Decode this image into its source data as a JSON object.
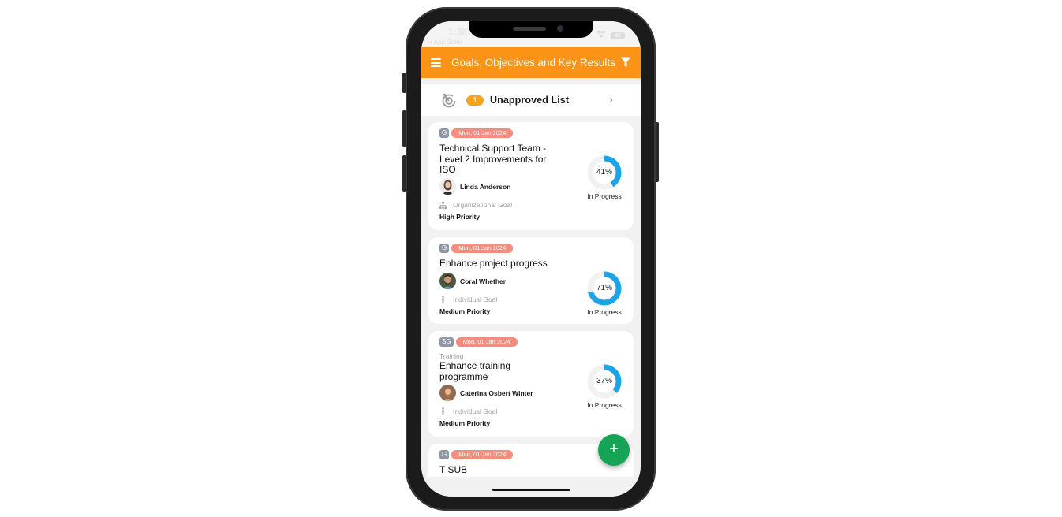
{
  "status_bar": {
    "time": "1:38",
    "back_label": "◂ App Store",
    "battery": "42"
  },
  "app_bar": {
    "title": "Goals, Objectives and Key Results",
    "menu_icon": "hamburger-menu-icon",
    "filter_icon": "filter-funnel-icon"
  },
  "unapproved": {
    "count": "1",
    "label": "Unapproved List",
    "icon": "radar-icon"
  },
  "colors": {
    "accent": "#fa9316",
    "badge": "#f7a318",
    "date_tag": "#f58c7e",
    "type_tag": "#8e97a5",
    "progress": "#1ea3e6",
    "fab": "#16a356"
  },
  "goals": [
    {
      "type": "G",
      "date": "Mon, 01 Jan 2024",
      "category": "",
      "title": "Technical Support Team - Level 2 Improvements for ISO",
      "owner": "Linda Anderson",
      "goal_type": "Organizational Goal",
      "priority": "High Priority",
      "progress": 41,
      "progress_label": "41%",
      "status": "In Progress"
    },
    {
      "type": "G",
      "date": "Mon, 01 Jan 2024",
      "category": "",
      "title": "Enhance project progress",
      "owner": "Coral Whether",
      "goal_type": "Individual Goal",
      "priority": "Medium Priority",
      "progress": 71,
      "progress_label": "71%",
      "status": "In Progress"
    },
    {
      "type": "SG",
      "date": "Mon, 01 Jan 2024",
      "category": "Training",
      "title": "Enhance training programme",
      "owner": "Caterina Osbert Winter",
      "goal_type": "Individual Goal",
      "priority": "Medium Priority",
      "progress": 37,
      "progress_label": "37%",
      "status": "In Progress"
    },
    {
      "type": "G",
      "date": "Mon, 01 Jan 2024",
      "title": "T SUB"
    }
  ],
  "fab": {
    "label": "+"
  }
}
